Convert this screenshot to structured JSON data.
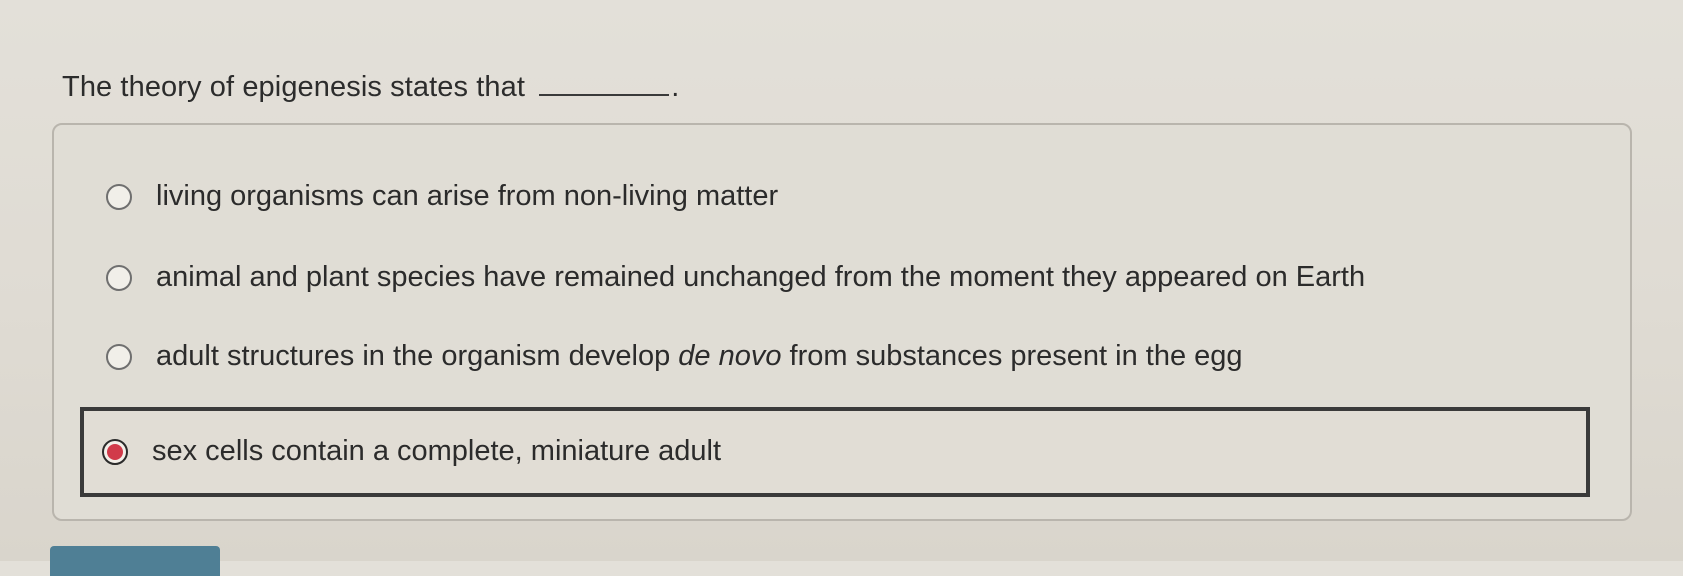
{
  "question": {
    "text": "The theory of epigenesis states that",
    "blank_suffix": "."
  },
  "options": [
    {
      "label_before": "living organisms can arise from non-living matter",
      "label_italic": "",
      "label_after": "",
      "selected": false
    },
    {
      "label_before": "animal and plant species have remained unchanged from the moment they appeared on Earth",
      "label_italic": "",
      "label_after": "",
      "selected": false
    },
    {
      "label_before": "adult structures in the organism develop ",
      "label_italic": "de novo",
      "label_after": " from substances present in the egg",
      "selected": false
    },
    {
      "label_before": "sex cells contain a complete, miniature adult",
      "label_italic": "",
      "label_after": "",
      "selected": true
    }
  ],
  "colors": {
    "selected_radio": "#d13a4a",
    "bottom_button": "#4f7f95"
  }
}
